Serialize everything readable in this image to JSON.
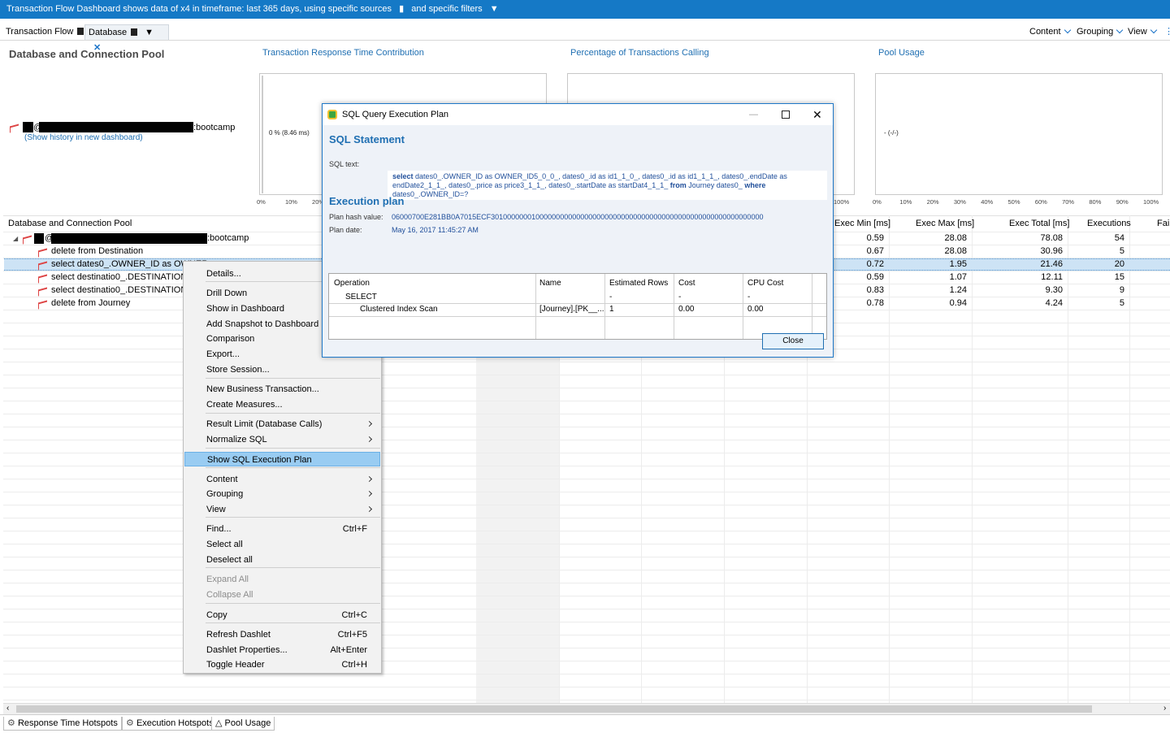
{
  "topbar": {
    "text1": "Transaction Flow Dashboard shows data of x4 in timeframe: last 365 days, using specific sources",
    "text2": "and specific filters"
  },
  "tabs": [
    {
      "label": "Transaction Flow"
    },
    {
      "label": "Database"
    }
  ],
  "right_menu": [
    "Content",
    "Grouping",
    "View"
  ],
  "dashlet_title": "Database and Connection Pool",
  "chart_titles": [
    "Transaction Response Time Contribution",
    "Percentage of Transactions Calling",
    "Pool Usage"
  ],
  "chart_labels": {
    "response_time": "0 % (8.46 ms)",
    "pool_usage": "- (-/-)"
  },
  "axis_ticks": {
    "chart1": [
      "0%",
      "10%",
      "20%"
    ],
    "chart2": [
      "100%"
    ],
    "chart3": [
      "0%",
      "10%",
      "20%",
      "30%",
      "40%",
      "50%",
      "60%",
      "70%",
      "80%",
      "90%",
      "100%"
    ]
  },
  "connection": {
    "host_suffix": ":bootcamp",
    "at": "@",
    "history_link": "(Show history in new dashboard)"
  },
  "table": {
    "tree_header": "Database and Connection Pool",
    "columns": [
      "Exec Min [ms]",
      "Exec Max [ms]",
      "Exec Total [ms]",
      "Executions",
      "Fail"
    ],
    "root_suffix": ":bootcamp",
    "root_at": "@",
    "rows": [
      {
        "name": "delete from Destination",
        "min": "0.59",
        "max": "28.08",
        "total": "78.08",
        "exec": "54"
      },
      {
        "name": "select dates0_.OWNER_ID as OWNER",
        "min": "0.67",
        "max": "28.08",
        "total": "30.96",
        "exec": "5"
      },
      {
        "name": "select destinatio0_.DESTINATION_ID",
        "min": "0.72",
        "max": "1.95",
        "total": "21.46",
        "exec": "20"
      },
      {
        "name": "select destinatio0_.DESTINATION_ID",
        "min": "0.59",
        "max": "1.07",
        "total": "12.11",
        "exec": "15"
      },
      {
        "name": "delete from Journey",
        "min": "0.83",
        "max": "1.24",
        "total": "9.30",
        "exec": "9"
      },
      {
        "name": "",
        "min": "0.78",
        "max": "0.94",
        "total": "4.24",
        "exec": "5"
      }
    ]
  },
  "context_menu": {
    "items": [
      {
        "label": "Details...",
        "shortcut": "",
        "submenu": false,
        "disabled": false
      },
      {
        "label": "Drill Down",
        "shortcut": "",
        "submenu": false,
        "disabled": false
      },
      {
        "label": "Show in Dashboard",
        "shortcut": "",
        "submenu": false,
        "disabled": false
      },
      {
        "label": "Add Snapshot to Dashboard",
        "shortcut": "",
        "submenu": false,
        "disabled": false
      },
      {
        "label": "Comparison",
        "shortcut": "",
        "submenu": false,
        "disabled": false
      },
      {
        "label": "Export...",
        "shortcut": "",
        "submenu": false,
        "disabled": false
      },
      {
        "label": "Store Session...",
        "shortcut": "",
        "submenu": false,
        "disabled": false
      },
      {
        "label": "New Business Transaction...",
        "shortcut": "",
        "submenu": false,
        "disabled": false
      },
      {
        "label": "Create Measures...",
        "shortcut": "",
        "submenu": false,
        "disabled": false
      },
      {
        "label": "Result Limit (Database Calls)",
        "shortcut": "",
        "submenu": true,
        "disabled": false
      },
      {
        "label": "Normalize SQL",
        "shortcut": "",
        "submenu": true,
        "disabled": false
      },
      {
        "label": "Show SQL Execution Plan",
        "shortcut": "",
        "submenu": false,
        "disabled": false,
        "highlighted": true
      },
      {
        "label": "Content",
        "shortcut": "",
        "submenu": true,
        "disabled": false
      },
      {
        "label": "Grouping",
        "shortcut": "",
        "submenu": true,
        "disabled": false
      },
      {
        "label": "View",
        "shortcut": "",
        "submenu": true,
        "disabled": false
      },
      {
        "label": "Find...",
        "shortcut": "Ctrl+F",
        "submenu": false,
        "disabled": false
      },
      {
        "label": "Select all",
        "shortcut": "",
        "submenu": false,
        "disabled": false
      },
      {
        "label": "Deselect all",
        "shortcut": "",
        "submenu": false,
        "disabled": false
      },
      {
        "label": "Expand All",
        "shortcut": "",
        "submenu": false,
        "disabled": true
      },
      {
        "label": "Collapse All",
        "shortcut": "",
        "submenu": false,
        "disabled": true
      },
      {
        "label": "Copy",
        "shortcut": "Ctrl+C",
        "submenu": false,
        "disabled": false
      },
      {
        "label": "Refresh Dashlet",
        "shortcut": "Ctrl+F5",
        "submenu": false,
        "disabled": false
      },
      {
        "label": "Dashlet Properties...",
        "shortcut": "Alt+Enter",
        "submenu": false,
        "disabled": false
      },
      {
        "label": "Toggle Header",
        "shortcut": "Ctrl+H",
        "submenu": false,
        "disabled": false
      }
    ]
  },
  "dialog": {
    "title": "SQL Query Execution Plan",
    "sql_heading": "SQL Statement",
    "sql_label": "SQL text:",
    "sql_line1a": "select",
    "sql_line1b": "dates0_.OWNER_ID as OWNER_ID5_0_0_, dates0_.id as id1_1_0_, dates0_.id as id1_1_1_, dates0_.endDate as",
    "sql_line2a": "endDate2_1_1_, dates0_.price as price3_1_1_, dates0_.startDate as startDat4_1_1_",
    "sql_line2b": "from",
    "sql_line2c": "Journey dates0_",
    "sql_line2d": "where",
    "sql_line3": "dates0_.OWNER_ID=?",
    "plan_heading": "Execution plan",
    "hash_label": "Plan hash value:",
    "hash_value": "06000700E281BB0A7015ECF3010000000100000000000000000000000000000000000000000000000000000000",
    "date_label": "Plan date:",
    "date_value": "May 16, 2017 11:45:27 AM",
    "plan_columns": [
      "Operation",
      "Name",
      "Estimated Rows",
      "Cost",
      "CPU Cost"
    ],
    "plan_rows": [
      {
        "op": "SELECT",
        "name": "",
        "rows": "-",
        "cost": "-",
        "cpu": "-"
      },
      {
        "op": "Clustered Index Scan",
        "name": "[Journey].[PK__...",
        "rows": "1",
        "cost": "0.00",
        "cpu": "0.00"
      }
    ],
    "close_label": "Close"
  },
  "bottom_tabs": [
    "Response Time Hotspots",
    "Execution Hotspots",
    "Pool Usage"
  ]
}
